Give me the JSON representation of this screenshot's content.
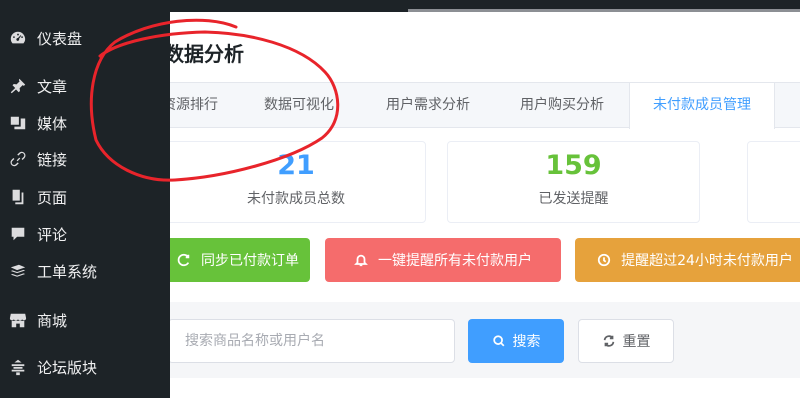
{
  "sidebar": {
    "items": [
      {
        "label": "仪表盘",
        "icon": "dashboard-icon"
      },
      {
        "label": "文章",
        "icon": "pin-icon"
      },
      {
        "label": "媒体",
        "icon": "media-icon"
      },
      {
        "label": "链接",
        "icon": "link-icon"
      },
      {
        "label": "页面",
        "icon": "page-icon"
      },
      {
        "label": "评论",
        "icon": "comment-icon"
      },
      {
        "label": "工单系统",
        "icon": "stack-icon"
      },
      {
        "label": "商城",
        "icon": "store-icon"
      },
      {
        "label": "论坛版块",
        "icon": "forum-icon"
      }
    ]
  },
  "main": {
    "title": "数据分析",
    "tabs": [
      {
        "label": "资源排行"
      },
      {
        "label": "数据可视化"
      },
      {
        "label": "用户需求分析"
      },
      {
        "label": "用户购买分析"
      },
      {
        "label": "未付款成员管理",
        "active": true
      }
    ],
    "stats": [
      {
        "value": "21",
        "label": "未付款成员总数",
        "color": "#409eff"
      },
      {
        "value": "159",
        "label": "已发送提醒",
        "color": "#67c23a"
      }
    ],
    "actions": [
      {
        "label": "同步已付款订单",
        "color": "#67c23a",
        "icon": "refresh-icon"
      },
      {
        "label": "一键提醒所有未付款用户",
        "color": "#f56c6c",
        "icon": "bell-icon"
      },
      {
        "label": "提醒超过24小时未付款用户",
        "color": "#e6a23c",
        "icon": "clock-icon"
      }
    ],
    "search": {
      "placeholder": "搜索商品名称或用户名",
      "search_label": "搜索",
      "reset_label": "重置"
    }
  },
  "colors": {
    "sidebar_bg": "#1d2327",
    "accent": "#409eff",
    "annotation": "#e8242b"
  }
}
